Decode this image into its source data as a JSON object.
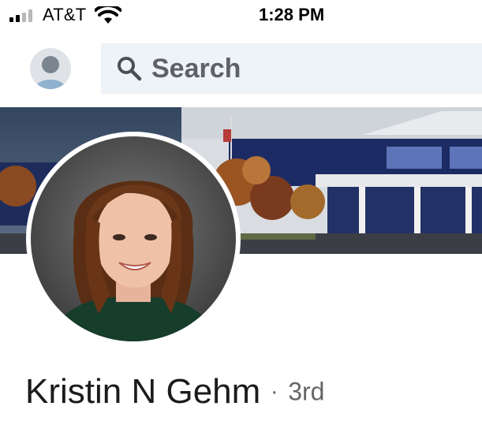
{
  "status_bar": {
    "carrier": "AT&T",
    "time": "1:28 PM"
  },
  "top_nav": {
    "search_placeholder": "Search"
  },
  "profile": {
    "name": "Kristin N Gehm",
    "separator": "·",
    "connection_degree": "3rd"
  },
  "icons": [
    "signal-icon",
    "wifi-icon",
    "search-icon",
    "user-avatar"
  ]
}
